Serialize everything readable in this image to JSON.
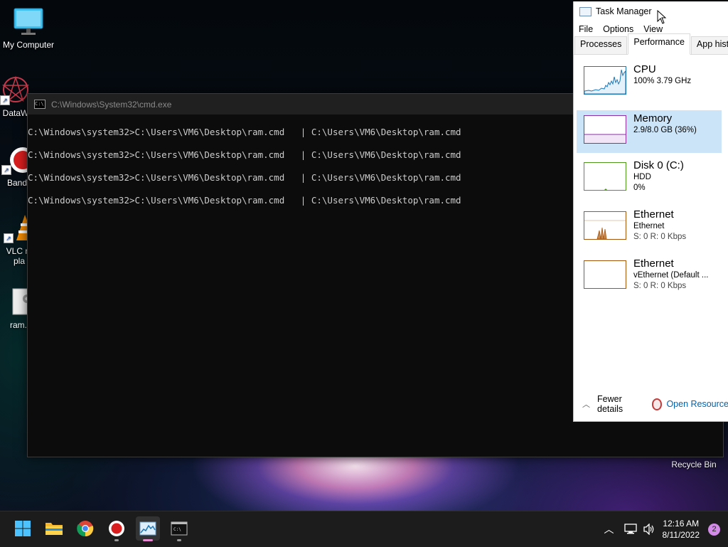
{
  "desktop": {
    "icons": [
      {
        "label": "My Computer"
      },
      {
        "label": "DataW"
      },
      {
        "label": "Band"
      },
      {
        "label": "VLC m\npla"
      },
      {
        "label": "ram."
      }
    ],
    "recycle_bin": "Recycle Bin"
  },
  "cmd": {
    "title": "C:\\Windows\\System32\\cmd.exe",
    "lines": [
      "C:\\Windows\\system32>C:\\Users\\VM6\\Desktop\\ram.cmd   | C:\\Users\\VM6\\Desktop\\ram.cmd",
      "C:\\Windows\\system32>C:\\Users\\VM6\\Desktop\\ram.cmd   | C:\\Users\\VM6\\Desktop\\ram.cmd",
      "C:\\Windows\\system32>C:\\Users\\VM6\\Desktop\\ram.cmd   | C:\\Users\\VM6\\Desktop\\ram.cmd",
      "C:\\Windows\\system32>C:\\Users\\VM6\\Desktop\\ram.cmd   | C:\\Users\\VM6\\Desktop\\ram.cmd"
    ]
  },
  "task_manager": {
    "title": "Task Manager",
    "menu": [
      "File",
      "Options",
      "View"
    ],
    "tabs": [
      "Processes",
      "Performance",
      "App history"
    ],
    "active_tab": "Performance",
    "resources": [
      {
        "name": "CPU",
        "line1": "100%  3.79 GHz",
        "line2": "",
        "color": "#1b77b6"
      },
      {
        "name": "Memory",
        "line1": "2.9/8.0 GB (36%)",
        "line2": "",
        "color": "#8b2fa8"
      },
      {
        "name": "Disk 0 (C:)",
        "line1": "HDD",
        "line2": "0%",
        "color": "#4f9a1e"
      },
      {
        "name": "Ethernet",
        "line1": "Ethernet",
        "line2": "S: 0  R: 0 Kbps",
        "color": "#a7560f"
      },
      {
        "name": "Ethernet",
        "line1": "vEthernet (Default ...",
        "line2": "S: 0  R: 0 Kbps",
        "color": "#a7560f"
      }
    ],
    "fewer_details": "Fewer details",
    "open_resource": "Open Resource"
  },
  "taskbar": {
    "apps": [
      "start-icon",
      "file-explorer-icon",
      "chrome-icon",
      "recorder-icon",
      "task-manager-icon",
      "cmd-icon"
    ],
    "clock_time": "12:16 AM",
    "clock_date": "8/11/2022",
    "notification_count": "2"
  }
}
